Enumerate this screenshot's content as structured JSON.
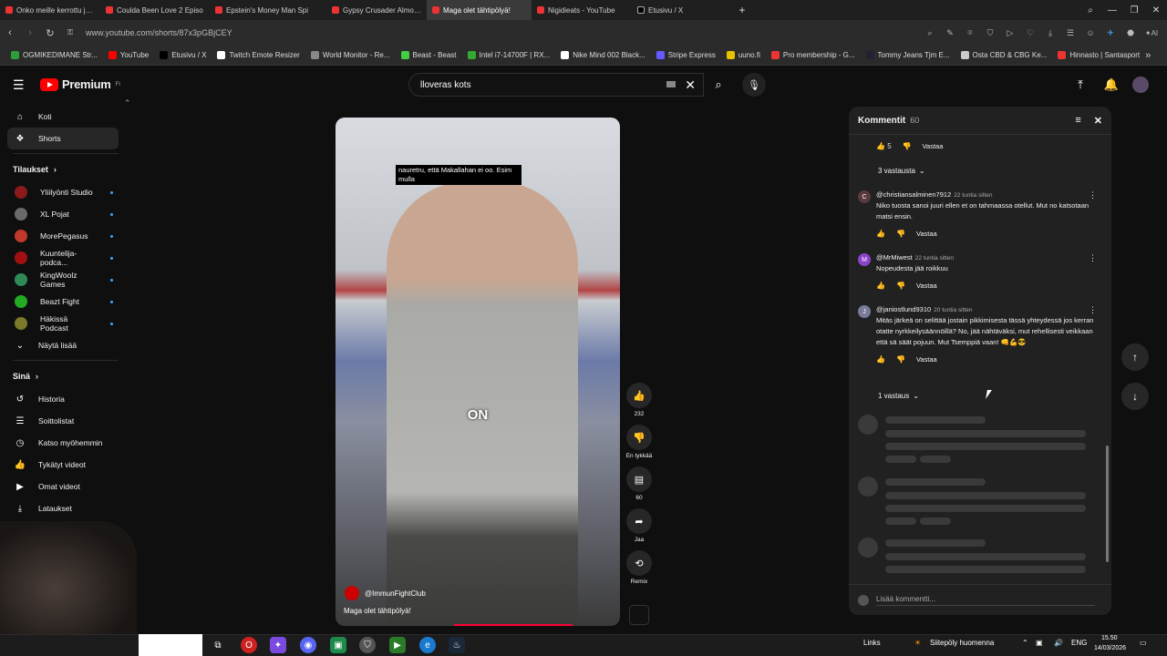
{
  "browser": {
    "tabs": [
      {
        "label": "Onko meille kerrottu jo ka",
        "active": false,
        "icon": "youtube-icon"
      },
      {
        "label": "Coulda Been Love 2 Episo",
        "active": false,
        "icon": "youtube-icon"
      },
      {
        "label": "Epstein's Money Man Spi",
        "active": false,
        "icon": "youtube-icon"
      },
      {
        "label": "Gypsy Crusader Almost P",
        "active": false,
        "icon": "youtube-icon"
      },
      {
        "label": "Maga olet tähtipölyä!",
        "active": true,
        "icon": "youtube-icon"
      },
      {
        "label": "Nigidieats - YouTube",
        "active": false,
        "icon": "youtube-icon"
      },
      {
        "label": "Etusivu / X",
        "active": false,
        "icon": "x-icon"
      }
    ],
    "url": "www.youtube.com/shorts/87x3pGBjCEY",
    "bookmarks": [
      {
        "label": "OGMIKEDIMANE Str...",
        "color": "#2e9e3a"
      },
      {
        "label": "YouTube",
        "color": "#ff0000"
      },
      {
        "label": "Etusivu / X",
        "color": "#000000"
      },
      {
        "label": "Twitch Emote Resizer",
        "color": "#ffffff"
      },
      {
        "label": "World Monitor - Re...",
        "color": "#888888"
      },
      {
        "label": "Beast - Beast",
        "color": "#44cc44"
      },
      {
        "label": "Intel i7-14700F | RX...",
        "color": "#33aa33"
      },
      {
        "label": "Nike Mind 002 Black...",
        "color": "#ffffff"
      },
      {
        "label": "Stripe Express",
        "color": "#635bff"
      },
      {
        "label": "uuno.fi",
        "color": "#e6c200"
      },
      {
        "label": "Pro membership - G...",
        "color": "#e33"
      },
      {
        "label": "Tommy Jeans Tjm E...",
        "color": "#223"
      },
      {
        "label": "Osta CBD & CBG Ke...",
        "color": "#ccc"
      },
      {
        "label": "Hinnasto | Santasport",
        "color": "#e33"
      }
    ]
  },
  "header": {
    "logo_text": "Premium",
    "logo_sup": "FI",
    "search_value": "lloveras kots"
  },
  "sidebar": {
    "main": [
      {
        "label": "Koti",
        "icon": "home-icon",
        "glyph": "⌂"
      },
      {
        "label": "Shorts",
        "icon": "shorts-icon",
        "glyph": "❖"
      }
    ],
    "subs_title": "Tilaukset",
    "subs": [
      {
        "label": "Yliilyönti Studio",
        "color": "#8b1a1a"
      },
      {
        "label": "XL Pojat",
        "color": "#6a6a6a"
      },
      {
        "label": "MorePegasus",
        "color": "#c0392b"
      },
      {
        "label": "Kuuntelija-podca...",
        "color": "#a01010"
      },
      {
        "label": "KingWoolz Games",
        "color": "#2e8b57"
      },
      {
        "label": "Beazt Fight",
        "color": "#22aa22"
      },
      {
        "label": "Häkissä Podcast",
        "color": "#7a7a2a"
      }
    ],
    "show_more": "Näytä lisää",
    "you_title": "Sinä",
    "you": [
      {
        "label": "Historia",
        "icon": "history-icon",
        "glyph": "↺"
      },
      {
        "label": "Soittolistat",
        "icon": "playlists-icon",
        "glyph": "☰"
      },
      {
        "label": "Katso myöhemmin",
        "icon": "watch-later-icon",
        "glyph": "◷"
      },
      {
        "label": "Tykätyt videot",
        "icon": "liked-icon",
        "glyph": "👍"
      },
      {
        "label": "Omat videot",
        "icon": "your-videos-icon",
        "glyph": "▶"
      },
      {
        "label": "Lataukset",
        "icon": "download-icon",
        "glyph": "⤓"
      }
    ]
  },
  "video": {
    "caption_top": "nauretru, että Makallahan ei oo. Esim mulla",
    "caption_mid": "ON",
    "channel": "@ImmunFightClub",
    "title": "Maga olet tähtipölyä!"
  },
  "actions": {
    "like_count": "232",
    "dislike_label": "En tykkää",
    "comments_count": "60",
    "share_label": "Jaa",
    "remix_label": "Remix"
  },
  "comments": {
    "title": "Kommentit",
    "count": "60",
    "top_likes": "5",
    "reply_label": "Vastaa",
    "replies_toggle_1": "3 vastausta",
    "items": [
      {
        "author": "@christiansalminen7912",
        "time": "22 tuntia sitten",
        "text": "Niko tuosta sanoi juuri ellen et on tahmaassa otellut. Mut no katsotaan matsi ensin.",
        "avatar": "C",
        "color": "#5a3a3a"
      },
      {
        "author": "@MrMiwest",
        "time": "22 tuntia sitten",
        "text": "Nopeudesta jää roikkuu",
        "avatar": "M",
        "color": "#8a44c8"
      },
      {
        "author": "@janiostlund9310",
        "time": "20 tuntia sitten",
        "text": "Mitäs järkeä on selittää jostain pikkimisesta tässä yhteydessä jos kerran otatte nyrkkeilysäännöillä? No, jää nähtäväksi, mut rehellisesti veikkaan että sä säät pojuun. Mut Tsemppiä vaan! 👊💪😎",
        "avatar": "J",
        "color": "#7a7a9a"
      }
    ],
    "replies_toggle_2": "1 vastaus",
    "add_placeholder": "Lisää kommentti..."
  },
  "taskbar": {
    "links": "Links",
    "weather": "Siitepöly huomenna",
    "lang": "ENG",
    "time": "15.50",
    "date": "14/03/2026"
  }
}
